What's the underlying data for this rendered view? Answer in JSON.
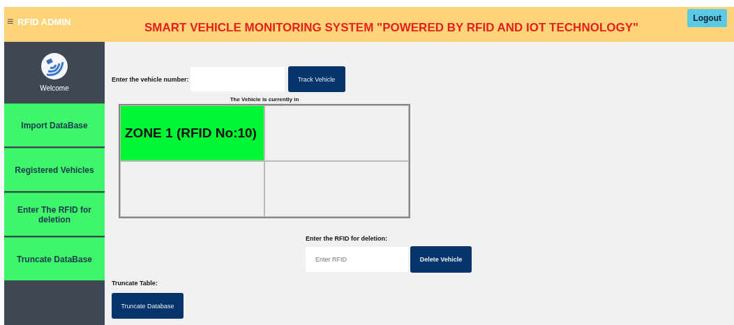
{
  "header": {
    "menu_glyph": "≡",
    "brand": "RFID ADMIN",
    "title": "SMART VEHICLE MONITORING SYSTEM \"POWERED BY RFID AND IOT TECHNOLOGY\"",
    "logout": "Logout"
  },
  "sidebar": {
    "welcome": "Welcome",
    "items": [
      {
        "label": "Import DataBase"
      },
      {
        "label": "Registered Vehicles"
      },
      {
        "label": "Enter The RFID for deletion"
      },
      {
        "label": "Truncate DataBase"
      }
    ]
  },
  "track": {
    "label": "Enter the vehicle number:",
    "button": "Track Vehicle"
  },
  "zones": {
    "caption": "The Vehicle is currently in",
    "cells": [
      {
        "text": "ZONE 1 (RFID No:10)",
        "active": true
      },
      {
        "active": false
      },
      {
        "active": false
      },
      {
        "active": false
      }
    ]
  },
  "deletion": {
    "label": "Enter the RFID for deletion:",
    "placeholder": "Enter RFID",
    "button": "Delete Vehicle"
  },
  "truncate": {
    "label": "Truncate Table:",
    "button": "Truncate Database"
  }
}
